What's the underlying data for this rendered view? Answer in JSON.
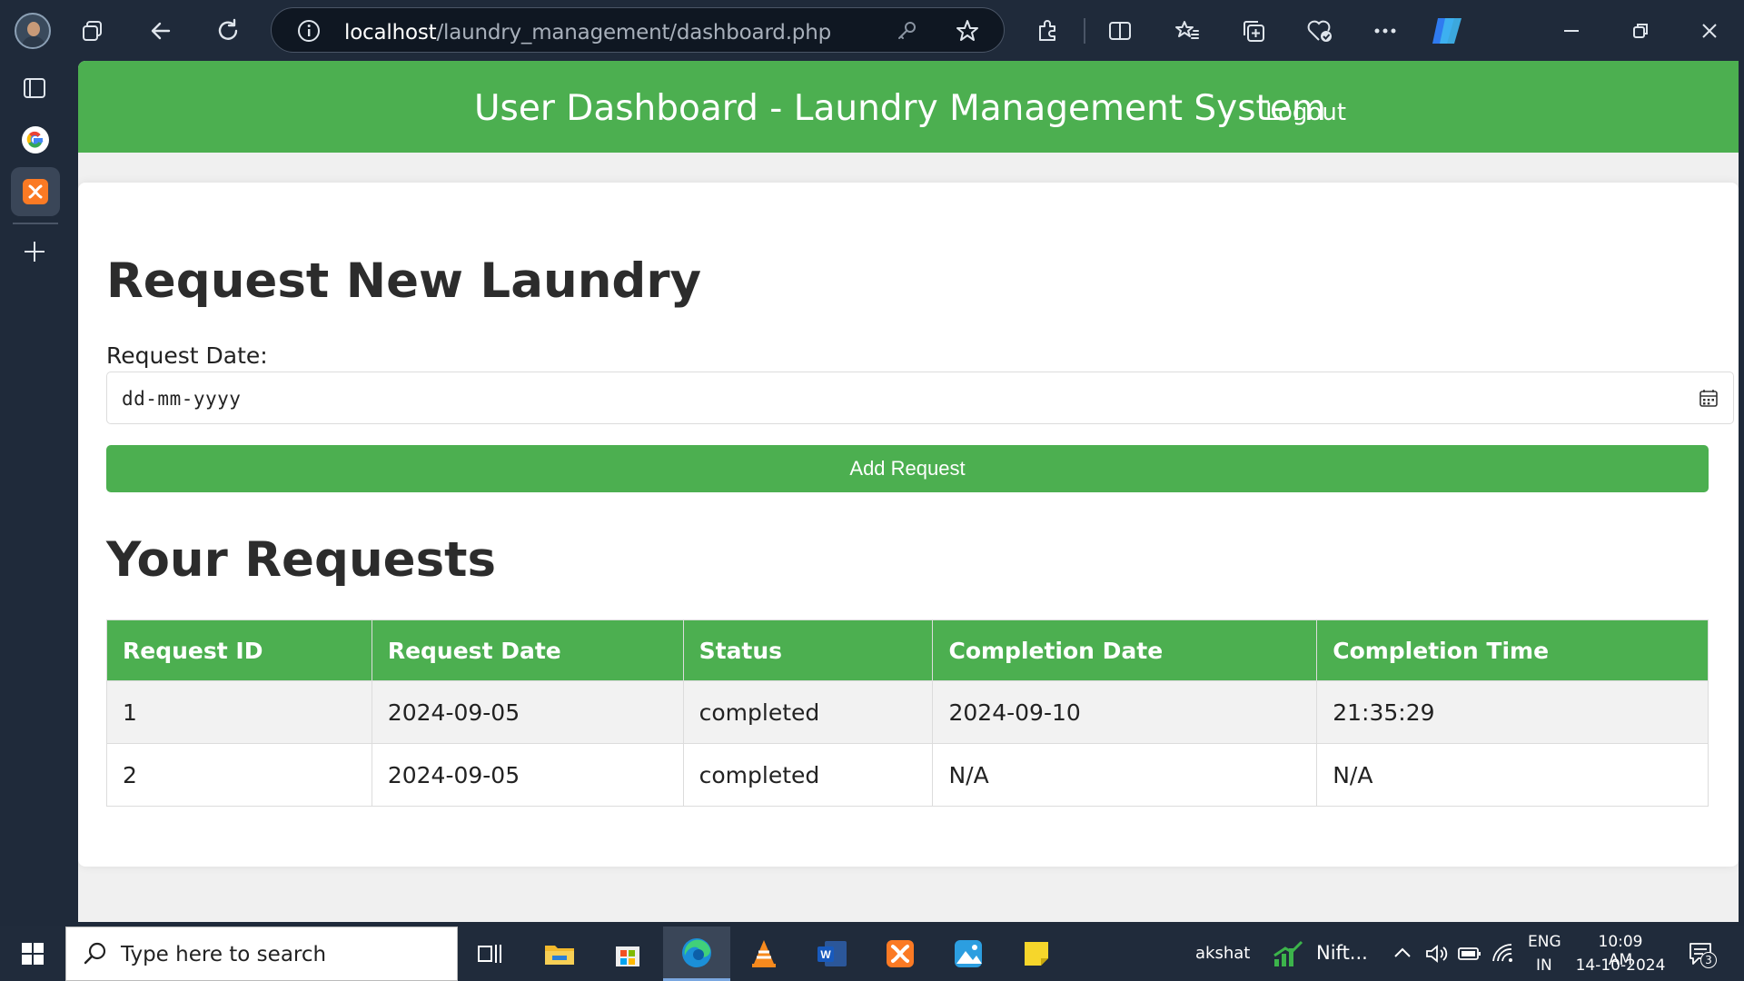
{
  "browser": {
    "url_host": "localhost",
    "url_path": "/laundry_management/dashboard.php"
  },
  "header": {
    "title": "User Dashboard - Laundry Management System",
    "logout": "Logout"
  },
  "form": {
    "heading": "Request New Laundry",
    "date_label": "Request Date:",
    "date_placeholder": "dd-mm-yyyy",
    "submit": "Add Request"
  },
  "requests": {
    "heading": "Your Requests",
    "columns": [
      "Request ID",
      "Request Date",
      "Status",
      "Completion Date",
      "Completion Time"
    ],
    "rows": [
      [
        "1",
        "2024-09-05",
        "completed",
        "2024-09-10",
        "21:35:29"
      ],
      [
        "2",
        "2024-09-05",
        "completed",
        "N/A",
        "N/A"
      ]
    ]
  },
  "taskbar": {
    "search_placeholder": "Type here to search",
    "user": "akshat",
    "stock_label": "Nift...",
    "lang_primary": "ENG",
    "lang_secondary": "IN",
    "time": "10:09 AM",
    "date": "14-10-2024",
    "notification_count": "3"
  },
  "colors": {
    "accent": "#4caf50",
    "chrome": "#1f2a3a"
  }
}
